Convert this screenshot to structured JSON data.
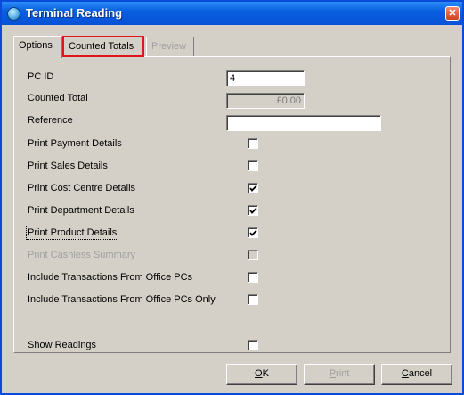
{
  "window": {
    "title": "Terminal Reading"
  },
  "tabs": [
    {
      "label": "Options",
      "state": "active"
    },
    {
      "label": "Counted Totals",
      "state": "highlighted"
    },
    {
      "label": "Preview",
      "state": "disabled"
    }
  ],
  "fields": {
    "pc_id": {
      "label": "PC ID",
      "value": "4"
    },
    "counted_total": {
      "label": "Counted Total",
      "value": "£0.00"
    },
    "reference": {
      "label": "Reference",
      "value": ""
    }
  },
  "options": [
    {
      "label": "Print Payment Details",
      "checked": false,
      "enabled": true
    },
    {
      "label": "Print Sales Details",
      "checked": false,
      "enabled": true
    },
    {
      "label": "Print Cost Centre Details",
      "checked": true,
      "enabled": true
    },
    {
      "label": "Print Department Details",
      "checked": true,
      "enabled": true
    },
    {
      "label": "Print Product Details",
      "checked": true,
      "enabled": true
    },
    {
      "label": "Print Cashless Summary",
      "checked": false,
      "enabled": false
    },
    {
      "label": "Include Transactions From Office PCs",
      "checked": false,
      "enabled": true
    },
    {
      "label": "Include Transactions From Office PCs Only",
      "checked": false,
      "enabled": true
    }
  ],
  "show_readings": {
    "label": "Show Readings",
    "checked": false
  },
  "buttons": {
    "ok": {
      "accel": "O",
      "rest": "K"
    },
    "print": {
      "accel": "P",
      "rest": "rint"
    },
    "cancel": {
      "accel": "C",
      "rest": "ancel"
    }
  },
  "colors": {
    "titlebar": "#0a5fe0",
    "highlight_border": "#e0161b",
    "face": "#d4d0c8"
  },
  "icons": {
    "app": "app-icon",
    "close": "close-icon",
    "check": "check-icon"
  }
}
